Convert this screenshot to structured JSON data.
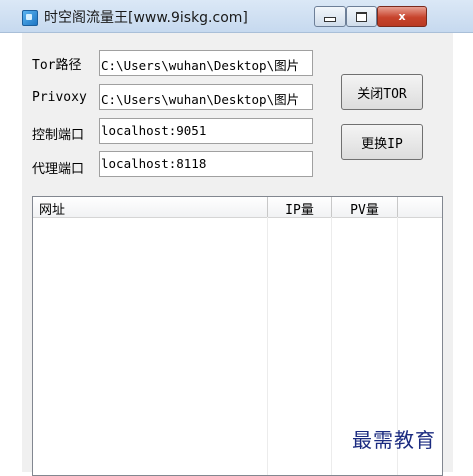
{
  "window": {
    "title": "时空阁流量王[www.9iskg.com]",
    "controls": {
      "minimize": "minimize",
      "maximize": "maximize",
      "close": "x"
    }
  },
  "form": {
    "tor_path": {
      "label": "Tor路径",
      "value": "C:\\Users\\wuhan\\Desktop\\图片"
    },
    "privoxy": {
      "label": "Privoxy",
      "value": "C:\\Users\\wuhan\\Desktop\\图片"
    },
    "control_port": {
      "label": "控制端口",
      "value": "localhost:9051"
    },
    "proxy_port": {
      "label": "代理端口",
      "value": "localhost:8118"
    }
  },
  "buttons": {
    "close_tor": "关闭TOR",
    "change_ip": "更换IP"
  },
  "list": {
    "columns": [
      "网址",
      "IP量",
      "PV量"
    ],
    "rows": []
  },
  "watermark": "最需教育",
  "icons": [
    "app-icon",
    "minimize-icon",
    "maximize-icon",
    "close-icon"
  ]
}
